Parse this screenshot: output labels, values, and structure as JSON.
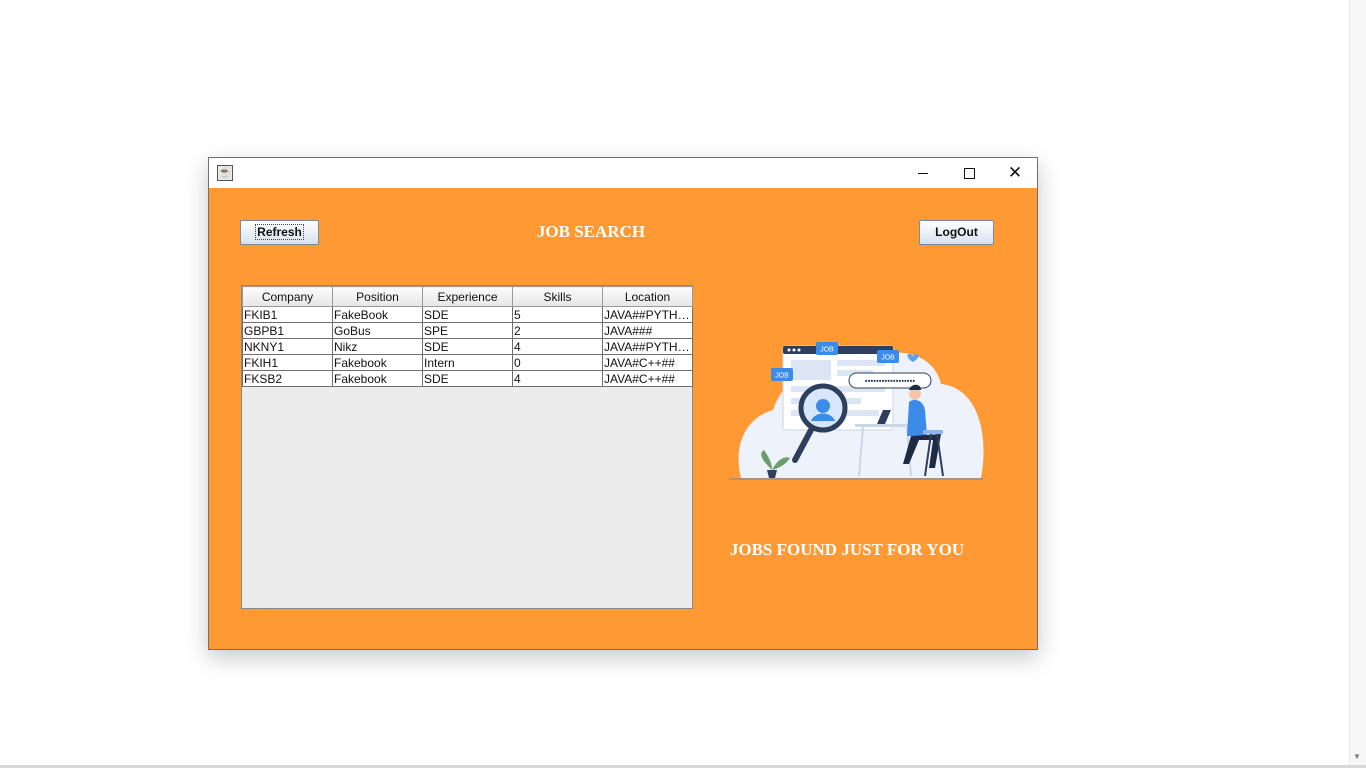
{
  "window": {
    "icon": "java-app-icon",
    "controls": {
      "minimize": "minimize-icon",
      "maximize": "maximize-icon",
      "close": "close-icon"
    }
  },
  "toolbar": {
    "refresh_label": "Refresh",
    "logout_label": "LogOut"
  },
  "page_title": "JOB SEARCH",
  "jobs_table": {
    "columns": [
      "Company",
      "Position",
      "Experience",
      "Skills",
      "Location"
    ],
    "rows": [
      [
        "FKIB1",
        "FakeBook",
        "SDE",
        "5",
        "JAVA##PYTHON"
      ],
      [
        "GBPB1",
        "GoBus",
        "SPE",
        "2",
        "JAVA###"
      ],
      [
        "NKNY1",
        "Nikz",
        "SDE",
        "4",
        "JAVA##PYTHON"
      ],
      [
        "FKIH1",
        "Fakebook",
        "Intern",
        "0",
        "JAVA#C++##"
      ],
      [
        "FKSB2",
        "Fakebook",
        "SDE",
        "4",
        "JAVA#C++##"
      ]
    ]
  },
  "illustration": {
    "badges": [
      "JOB",
      "JOB",
      "JOB"
    ],
    "search_text": "••••••••••••••••••"
  },
  "tagline": "JOBS FOUND JUST FOR YOU",
  "colors": {
    "background": "#ff9933",
    "accent_blue": "#3d8be8",
    "text_light": "#ffffff"
  }
}
